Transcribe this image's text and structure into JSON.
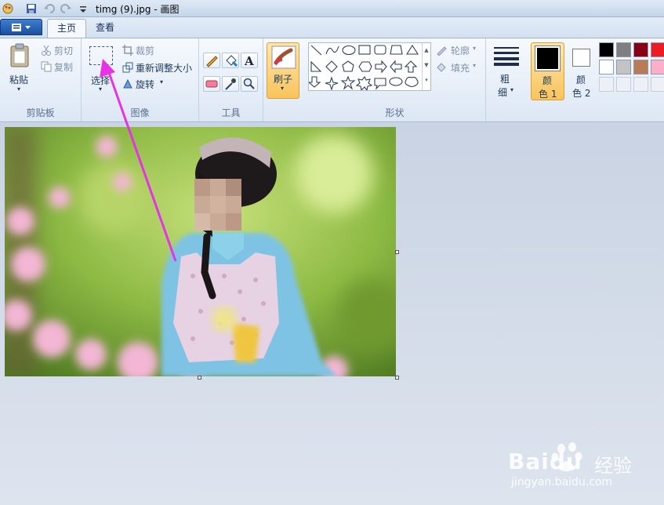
{
  "window": {
    "title": "timg (9).jpg - 画图"
  },
  "tabs": [
    {
      "label": "主页"
    },
    {
      "label": "查看"
    }
  ],
  "clipboard": {
    "paste": "粘贴",
    "cut": "剪切",
    "copy": "复制",
    "group": "剪贴板"
  },
  "image": {
    "select": "选择",
    "crop": "裁剪",
    "resize": "重新调整大小",
    "rotate": "旋转",
    "group": "图像"
  },
  "tools": {
    "group": "工具"
  },
  "brush": {
    "label": "刷子"
  },
  "shapes": {
    "outline": "轮廓",
    "fill": "填充",
    "group": "形状"
  },
  "size": {
    "label1": "粗",
    "label2": "细"
  },
  "color1": {
    "label1": "颜",
    "label2": "色 1"
  },
  "color2": {
    "label1": "颜",
    "label2": "色 2"
  },
  "palette": [
    "#000000",
    "#7f7f7f",
    "#880015",
    "#ed1c24",
    "#ffffff",
    "#c3c3c3",
    "#b97a57",
    "#ffaec9"
  ],
  "watermark": {
    "brand": "Baidu",
    "sub": "经验",
    "url": "jingyan.baidu.com"
  },
  "colors": {
    "arrow": "#e633e6",
    "accent": "#f7c86a"
  }
}
